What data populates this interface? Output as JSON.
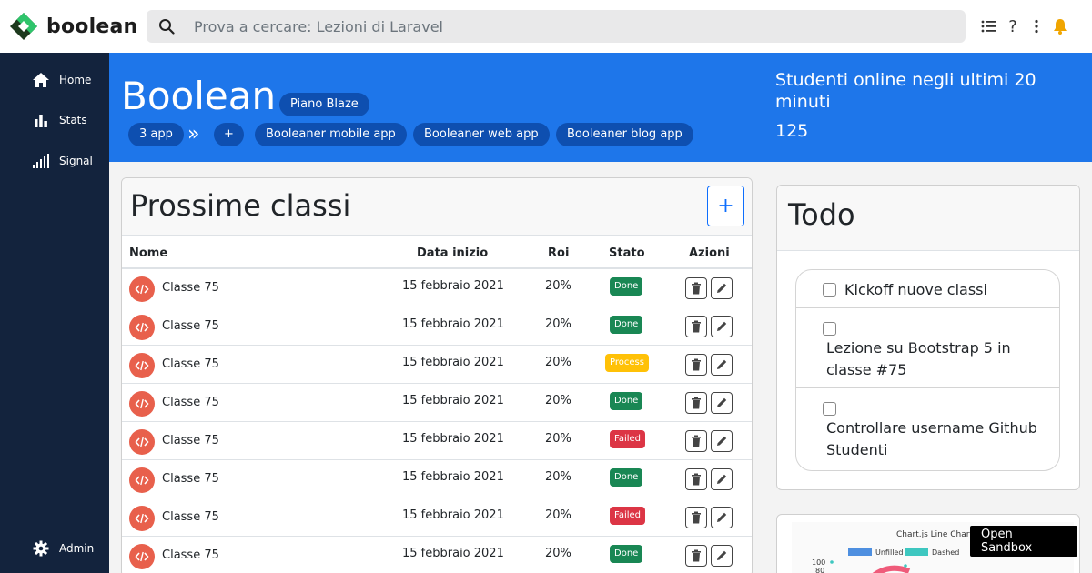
{
  "app": {
    "logo_text": "boolean"
  },
  "search": {
    "placeholder": "Prova a cercare: Lezioni di Laravel"
  },
  "sidebar": {
    "items": [
      {
        "label": "Home",
        "icon": "home-icon"
      },
      {
        "label": "Stats",
        "icon": "bar-chart-icon"
      },
      {
        "label": "Signal",
        "icon": "signal-icon"
      }
    ],
    "bottom": {
      "label": "Admin",
      "icon": "gear-icon"
    }
  },
  "hero": {
    "title": "Boolean",
    "plan": "Piano Blaze",
    "apps_count": "3 app",
    "add_label": "+",
    "apps": [
      "Booleaner mobile app",
      "Booleaner web app",
      "Booleaner blog app"
    ],
    "online_label": "Studenti online negli ultimi 20 minuti",
    "online_count": "125"
  },
  "classes": {
    "title": "Prossime classi",
    "add_button": "+",
    "columns": [
      "Nome",
      "Data inizio",
      "Roi",
      "Stato",
      "Azioni"
    ],
    "rows": [
      {
        "name": "Classe 75",
        "date": "15 febbraio 2021",
        "roi": "20%",
        "status": "Done"
      },
      {
        "name": "Classe 75",
        "date": "15 febbraio 2021",
        "roi": "20%",
        "status": "Done"
      },
      {
        "name": "Classe 75",
        "date": "15 febbraio 2021",
        "roi": "20%",
        "status": "Process"
      },
      {
        "name": "Classe 75",
        "date": "15 febbraio 2021",
        "roi": "20%",
        "status": "Done"
      },
      {
        "name": "Classe 75",
        "date": "15 febbraio 2021",
        "roi": "20%",
        "status": "Failed"
      },
      {
        "name": "Classe 75",
        "date": "15 febbraio 2021",
        "roi": "20%",
        "status": "Done"
      },
      {
        "name": "Classe 75",
        "date": "15 febbraio 2021",
        "roi": "20%",
        "status": "Failed"
      },
      {
        "name": "Classe 75",
        "date": "15 febbraio 2021",
        "roi": "20%",
        "status": "Done"
      }
    ]
  },
  "todo": {
    "title": "Todo",
    "items": [
      {
        "text": "Kickoff nuove classi",
        "checked": false
      },
      {
        "text": "Lezione su Bootstrap 5 in classe #75",
        "checked": false
      },
      {
        "text": "Controllare username Github Studenti",
        "checked": false
      }
    ]
  },
  "chart_preview": {
    "title": "Chart.js Line Chart",
    "legend": [
      "Unfilled",
      "Dashed"
    ],
    "ticks": [
      "100",
      "80"
    ],
    "sandbox_label": "Open Sandbox"
  },
  "colors": {
    "accent": "#1e76ea",
    "sidebar": "#13233d",
    "done": "#198754",
    "process": "#ffc107",
    "failed": "#dc3545",
    "class_icon": "#e8604c"
  }
}
